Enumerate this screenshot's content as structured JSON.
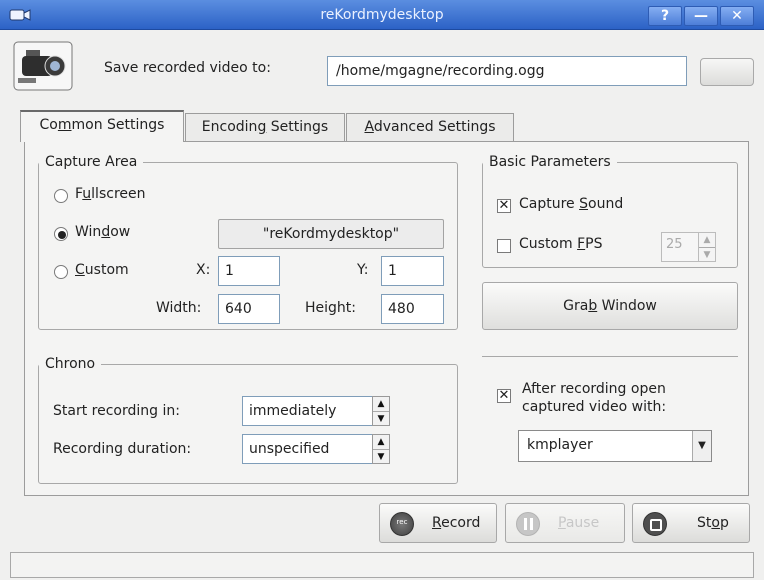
{
  "window": {
    "title": "reKordmydesktop",
    "help_label": "?",
    "minimize_label": "—",
    "close_label": "✕"
  },
  "top": {
    "save_label": "Save recorded video to:",
    "path_value": "/home/mgagne/recording.ogg",
    "browse_label": ""
  },
  "tabs": [
    {
      "label_pre": "Co",
      "label_u": "m",
      "label_post": "mon Settings"
    },
    {
      "label_pre": "Encodin",
      "label_u": "g",
      "label_post": " Settings"
    },
    {
      "label_pre": "",
      "label_u": "A",
      "label_post": "dvanced Settings"
    }
  ],
  "capture": {
    "legend": "Capture Area",
    "fullscreen_pre": "F",
    "fullscreen_u": "u",
    "fullscreen_post": "llscreen",
    "window_pre": "Win",
    "window_u": "d",
    "window_post": "ow",
    "window_name": "\"reKordmydesktop\"",
    "custom_pre": "",
    "custom_u": "C",
    "custom_post": "ustom",
    "x_label": "X:",
    "x_value": "1",
    "y_label": "Y:",
    "y_value": "1",
    "width_label": "Width:",
    "width_value": "640",
    "height_label": "Height:",
    "height_value": "480"
  },
  "basic": {
    "legend": "Basic Parameters",
    "capture_sound_pre": "Capture ",
    "capture_sound_u": "S",
    "capture_sound_post": "ound",
    "custom_fps_pre": "Custom ",
    "custom_fps_u": "F",
    "custom_fps_post": "PS",
    "fps_value": "25"
  },
  "grab_button": {
    "pre": "Gra",
    "u": "b",
    "post": " Window"
  },
  "chrono": {
    "legend": "Chrono",
    "start_label": "Start recording in:",
    "start_value": "immediately",
    "duration_label": "Recording duration:",
    "duration_value": "unspecified"
  },
  "after": {
    "label_line1": "After recording open",
    "label_line2": "captured video with:",
    "player": "kmplayer"
  },
  "buttons": {
    "record_pre": "",
    "record_u": "R",
    "record_post": "ecord",
    "pause_pre": "",
    "pause_u": "P",
    "pause_post": "ause",
    "stop_pre": "St",
    "stop_u": "o",
    "stop_post": "p"
  },
  "state": {
    "capture_mode": "window",
    "capture_sound": true,
    "custom_fps": false,
    "open_after_recording": true,
    "active_tab": "common"
  }
}
